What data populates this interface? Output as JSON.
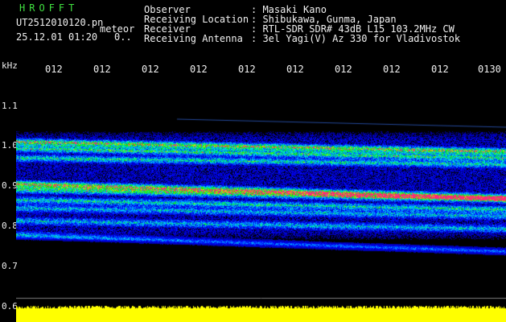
{
  "header": {
    "app_name": "HROFFT",
    "filename": "UT2512010120.pn",
    "timestamp": "25.12.01 01:20",
    "count": "0..",
    "tag": "meteor",
    "fields": [
      {
        "label": "Observer",
        "value": ": Masaki Kano"
      },
      {
        "label": "Receiving Location",
        "value": ": Shibukawa, Gunma, Japan"
      },
      {
        "label": "Receiver",
        "value": ": RTL-SDR SDR# 43dB L15 103.2MHz CW"
      },
      {
        "label": "Receiving Antenna",
        "value": ": 3el Yagi(V) Az 330 for Vladivostok"
      }
    ]
  },
  "axes": {
    "y_unit": "kHz",
    "y_ticks": [
      {
        "label": "1.1",
        "value": 1.1
      },
      {
        "label": "1.0",
        "value": 1.0
      },
      {
        "label": "0.9",
        "value": 0.9
      },
      {
        "label": "0.8",
        "value": 0.8
      },
      {
        "label": "0.7",
        "value": 0.7
      },
      {
        "label": "0.6",
        "value": 0.6
      }
    ],
    "x_ticks": [
      "012",
      "012",
      "012",
      "012",
      "012",
      "012",
      "012",
      "012",
      "012",
      "0130"
    ]
  },
  "colors": {
    "background": "#000000",
    "text": "#f0f0f0",
    "app_name": "#40e040",
    "floor": "#ffff00"
  }
}
